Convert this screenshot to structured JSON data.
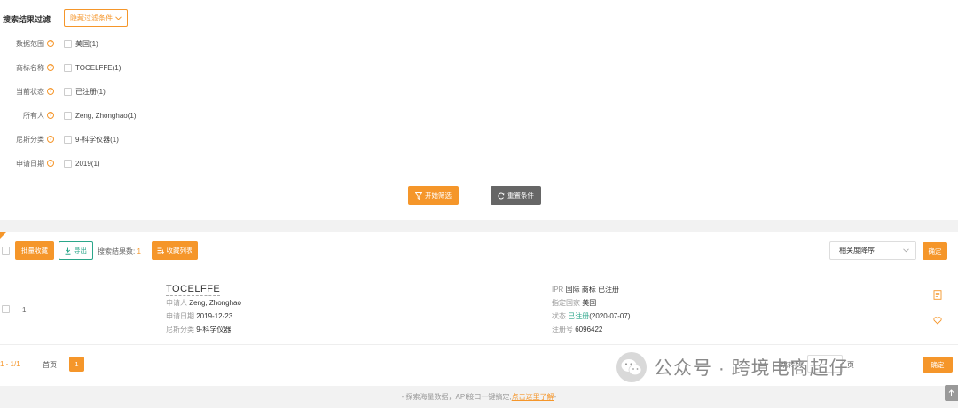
{
  "filter": {
    "title": "搜索结果过滤",
    "hide_label": "隐藏过滤条件",
    "rows": [
      {
        "label": "数据范围",
        "option": "美国(1)"
      },
      {
        "label": "商标名称",
        "option": "TOCELFFE(1)"
      },
      {
        "label": "当前状态",
        "option": "已注册(1)"
      },
      {
        "label": "所有人",
        "option": "Zeng, Zhonghao(1)"
      },
      {
        "label": "尼斯分类",
        "option": "9-科学仪器(1)"
      },
      {
        "label": "申请日期",
        "option": "2019(1)"
      }
    ],
    "start_label": "开始筛选",
    "reset_label": "重置条件"
  },
  "toolbar": {
    "batch_fav": "批量收藏",
    "export": "导出",
    "count_label": "搜索结果数:",
    "count": "1",
    "fav_list": "收藏列表",
    "sort": "相关度降序",
    "confirm": "确定"
  },
  "result": {
    "index": "1",
    "name": "TOCELFFE",
    "applicant_label": "申请人",
    "applicant": "Zeng, Zhonghao",
    "date_label": "申请日期",
    "date": "2019-12-23",
    "class_label": "尼斯分类",
    "class": "9-科学仪器",
    "ipr_label": "IPR",
    "ipr": "国际 商标 已注册",
    "country_label": "指定国家",
    "country": "美国",
    "status_label": "状态",
    "status": "已注册",
    "status_date": "(2020-07-07)",
    "reg_label": "注册号",
    "reg": "6096422"
  },
  "pagination": {
    "range": "1 - 1/1",
    "first": "首页",
    "page": "1",
    "goto_prefix": "跳转到",
    "goto_suffix": "页",
    "confirm": "确定"
  },
  "watermark": {
    "text": "公众号 · 跨境电商超仔"
  },
  "footer": {
    "text": "- 探索海量数据，API接口一键搞定,",
    "link": "点击这里了解",
    "dash": " -"
  },
  "colors": {
    "accent": "#f5962a",
    "green": "#2aa68a"
  }
}
